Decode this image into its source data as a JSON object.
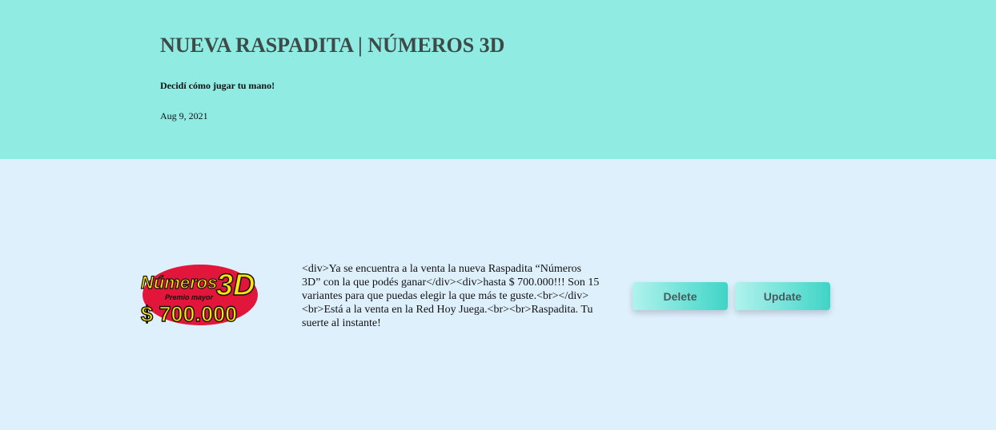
{
  "header": {
    "title": "NUEVA RASPADITA | NÚMEROS 3D",
    "subtitle": "Decidí cómo jugar tu mano!",
    "date": "Aug 9, 2021"
  },
  "post": {
    "image": {
      "line1": "Números",
      "line1_suffix": "3D",
      "line2": "Premio mayor",
      "line3": "$ 700.000"
    },
    "body": "<div>Ya se encuentra a la venta la nueva Raspadita “Números 3D” con la que podés ganar</div><div>hasta $ 700.000!!! Son 15 variantes para que puedas elegir la que más te guste.<br></div><br>Está a la venta en la Red Hoy Juega.<br><br>Raspadita. Tu suerte al instante!"
  },
  "actions": {
    "delete_label": "Delete",
    "update_label": "Update"
  },
  "colors": {
    "header_bg": "#90ebe3",
    "content_bg": "#dff0fd",
    "button_gradient_start": "#b0f3ee",
    "button_gradient_end": "#3fd4c6",
    "logo_red": "#e2153a",
    "logo_yellow": "#ffe600"
  }
}
